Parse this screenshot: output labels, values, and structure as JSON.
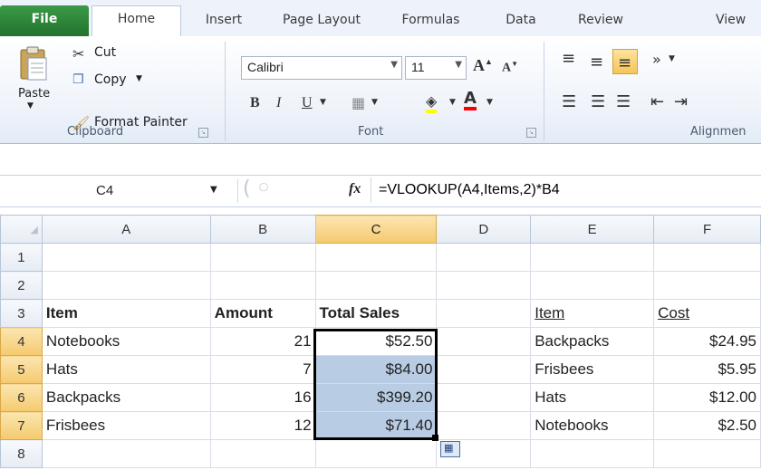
{
  "tabs": [
    "File",
    "Home",
    "Insert",
    "Page Layout",
    "Formulas",
    "Data",
    "Review",
    "View"
  ],
  "clipboard": {
    "paste_label": "Paste",
    "cut_label": "Cut",
    "copy_label": "Copy",
    "format_painter_label": "Format Painter",
    "group_label": "Clipboard"
  },
  "font": {
    "font_name": "Calibri",
    "font_size": "11",
    "group_label": "Font"
  },
  "alignment": {
    "group_label": "Alignmen"
  },
  "formula_bar": {
    "name_box": "C4",
    "fx": "fx",
    "formula": "=VLOOKUP(A4,Items,2)*B4"
  },
  "grid": {
    "columns": [
      "A",
      "B",
      "C",
      "D",
      "E",
      "F"
    ],
    "rows": [
      "1",
      "2",
      "3",
      "4",
      "5",
      "6",
      "7",
      "8"
    ],
    "cells": {
      "A3": "Item",
      "B3": "Amount",
      "C3": "Total Sales",
      "E3": "Item",
      "F3": "Cost",
      "A4": "Notebooks",
      "B4": "21",
      "C4": "$52.50",
      "E4": "Backpacks",
      "F4": "$24.95",
      "A5": "Hats",
      "B5": "7",
      "C5": "$84.00",
      "E5": "Frisbees",
      "F5": "$5.95",
      "A6": "Backpacks",
      "B6": "16",
      "C6": "$399.20",
      "E6": "Hats",
      "F6": "$12.00",
      "A7": "Frisbees",
      "B7": "12",
      "C7": "$71.40",
      "E7": "Notebooks",
      "F7": "$2.50"
    }
  },
  "colors": {
    "file_tab": "#2f7f3c",
    "selection_fill": "#b8cce4",
    "header_selected": "#f5c96e"
  }
}
